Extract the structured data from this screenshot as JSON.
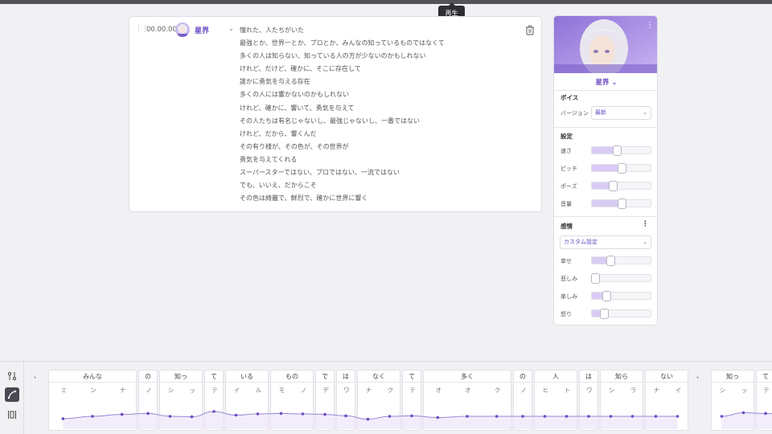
{
  "tooltip": "再生",
  "editor": {
    "time": "00.00.00",
    "speaker": "星界",
    "lines": [
      "憧れた、人たちがいた",
      "最強とか、世界一とか、プロとか、みんなの知っているものではなくて",
      "多くの人は知らない、知っている人の方が少ないのかもしれない",
      "けれど、だけど、確かに、そこに存在して",
      "誰かに勇気を与える存在",
      "多くの人には響かないのかもしれない",
      "けれど、確かに、響いて、勇気を与えて",
      "その人たちは有名じゃないし、最強じゃないし、一番ではない",
      "けれど、だから、響くんだ",
      "その有り様が、その色が、その世界が",
      "勇気を与えてくれる",
      "スーパースターではない、プロではない、一流ではない",
      "でも、いいえ、だからこそ",
      "その色は綺麗で、鮮烈で、確かに世界に響く"
    ]
  },
  "panel": {
    "name": "星界",
    "voice_title": "ボイス",
    "version_label": "バージョン",
    "version_value": "最新",
    "settings_title": "設定",
    "settings": [
      {
        "label": "速さ",
        "value": 0.42
      },
      {
        "label": "ピッチ",
        "value": 0.5
      },
      {
        "label": "ポーズ",
        "value": 0.36
      },
      {
        "label": "音量",
        "value": 0.5
      }
    ],
    "emotion_title": "感情",
    "emotion_preset": "カスタム設定",
    "emotions": [
      {
        "label": "幸せ",
        "value": 0.32
      },
      {
        "label": "悲しみ",
        "value": 0.06
      },
      {
        "label": "楽しみ",
        "value": 0.24
      },
      {
        "label": "怒り",
        "value": 0.2
      }
    ]
  },
  "colors": {
    "accent": "#6a4cc4",
    "fill": "#d9ccf4"
  },
  "phrases": [
    {
      "word": "、",
      "kana": [],
      "gap": true
    },
    {
      "word": "みんな",
      "kana": [
        "ミ",
        "ン",
        "ナ"
      ]
    },
    {
      "word": "の",
      "kana": [
        "ノ"
      ]
    },
    {
      "word": "知っ",
      "kana": [
        "シ",
        "ッ"
      ]
    },
    {
      "word": "て",
      "kana": [
        "テ"
      ]
    },
    {
      "word": "いる",
      "kana": [
        "イ",
        "ル"
      ]
    },
    {
      "word": "もの",
      "kana": [
        "モ",
        "ノ"
      ]
    },
    {
      "word": "で",
      "kana": [
        "デ"
      ]
    },
    {
      "word": "は",
      "kana": [
        "ワ"
      ]
    },
    {
      "word": "なく",
      "kana": [
        "ナ",
        "ク"
      ]
    },
    {
      "word": "て",
      "kana": [
        "テ"
      ]
    },
    {
      "word": "多く",
      "kana": [
        "オ",
        "オ",
        "ク"
      ]
    },
    {
      "word": "の",
      "kana": [
        "ノ"
      ]
    },
    {
      "word": "人",
      "kana": [
        "ヒ",
        "ト"
      ]
    },
    {
      "word": "は",
      "kana": [
        "ワ"
      ]
    },
    {
      "word": "知ら",
      "kana": [
        "シ",
        "ラ"
      ]
    },
    {
      "word": "ない",
      "kana": [
        "ナ",
        "イ"
      ]
    },
    {
      "word": "、",
      "kana": [],
      "gap": true
    },
    {
      "word": "知っ",
      "kana": [
        "シ",
        "ッ"
      ]
    },
    {
      "word": "て",
      "kana": [
        "テ"
      ]
    },
    {
      "word": "い",
      "kana": [
        "イ"
      ]
    }
  ],
  "pitch_segments": [
    [
      0.3,
      0.4,
      0.48,
      0.52,
      0.4,
      0.38,
      0.6,
      0.45,
      0.5,
      0.52,
      0.5,
      0.48,
      0.42,
      0.28,
      0.4,
      0.42,
      0.35
    ],
    [
      0.4,
      0.55,
      0.52,
      0.42,
      0.32,
      0.33,
      0.34,
      0.33,
      0.32,
      0.33,
      0.36,
      0.46,
      0.48
    ],
    [
      0.45,
      0.55,
      0.5,
      0.56
    ]
  ]
}
